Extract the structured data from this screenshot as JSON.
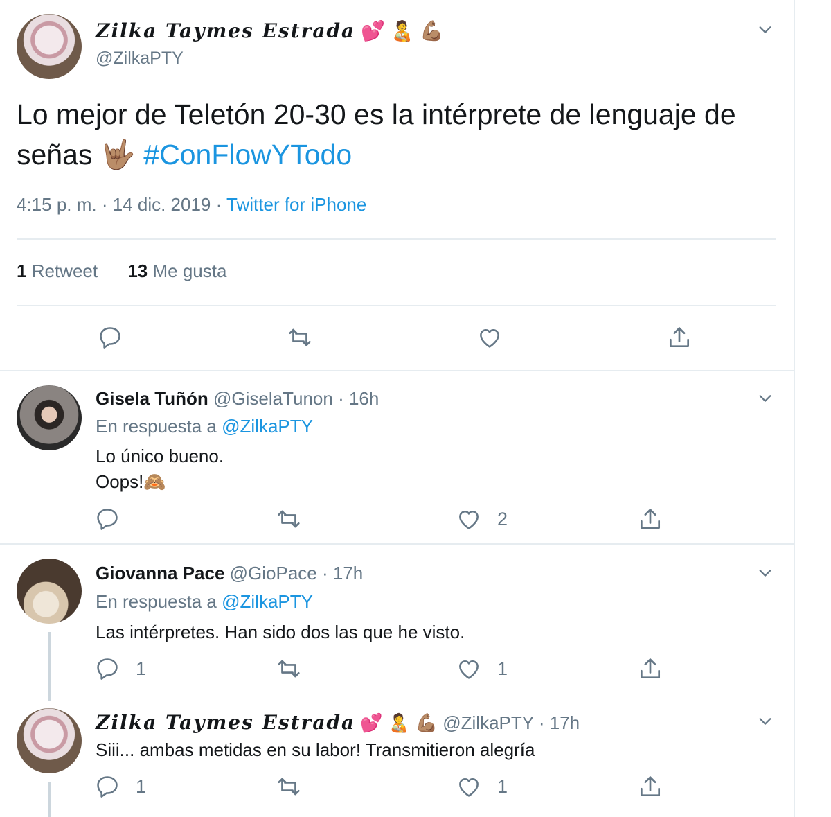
{
  "main": {
    "display_name": "Zilka Taymes Estrada",
    "name_emojis": [
      "💕",
      "🧑‍🍼",
      "💪🏽"
    ],
    "handle": "@ZilkaPTY",
    "text_plain": "Lo mejor de Teletón 20-30 es la intérprete de lenguaje de señas",
    "text_emoji": "🤟🏽",
    "hashtag": "#ConFlowYTodo",
    "time": "4:15 p. m. · 14 dic. 2019 · ",
    "source": "Twitter for iPhone",
    "retweets_count": "1",
    "retweets_label": "Retweet",
    "likes_count": "13",
    "likes_label": "Me gusta"
  },
  "replies": [
    {
      "name": "Gisela Tuñón",
      "handle": "@GiselaTunon · 16h",
      "in_reply_prefix": "En respuesta a ",
      "in_reply_to": "@ZilkaPTY",
      "text_line1": "Lo único bueno.",
      "text_line2": "Oops!",
      "text_emoji": "🙈",
      "reply_count": "",
      "retweet_count": "",
      "like_count": "2"
    },
    {
      "name": "Giovanna Pace",
      "handle": "@GioPace · 17h",
      "in_reply_prefix": "En respuesta a ",
      "in_reply_to": "@ZilkaPTY",
      "text_line1": "Las intérpretes. Han sido dos las que he visto.",
      "reply_count": "1",
      "retweet_count": "",
      "like_count": "1"
    },
    {
      "name": "Zilka Taymes Estrada",
      "name_emojis": [
        "💕",
        "🧑‍🍼",
        "💪🏽"
      ],
      "handle": "@ZilkaPTY · 17h",
      "text_line1": "Siii... ambas metidas en su labor! Transmitieron alegría",
      "reply_count": "1",
      "retweet_count": "",
      "like_count": "1"
    }
  ],
  "colors": {
    "link": "#1b95e0",
    "muted": "#657786",
    "text": "#14171a",
    "border": "#e6ecf0"
  }
}
